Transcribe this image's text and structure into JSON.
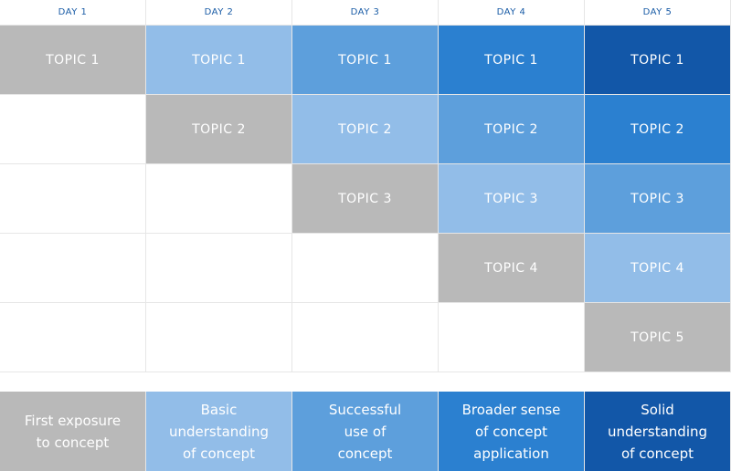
{
  "colors": {
    "gray": "#b9b9b9",
    "level1": "#92bde8",
    "level2": "#5d9fdc",
    "level3": "#2b80d0",
    "level4": "#1257a8",
    "empty": "#ffffff",
    "header_text": "#1a5ca6"
  },
  "days": [
    "DAY 1",
    "DAY 2",
    "DAY 3",
    "DAY 4",
    "DAY 5"
  ],
  "rows": [
    [
      {
        "label": "TOPIC 1",
        "level": 0
      },
      {
        "label": "TOPIC 1",
        "level": 1
      },
      {
        "label": "TOPIC 1",
        "level": 2
      },
      {
        "label": "TOPIC 1",
        "level": 3
      },
      {
        "label": "TOPIC 1",
        "level": 4
      }
    ],
    [
      {
        "label": "",
        "level": -1
      },
      {
        "label": "TOPIC 2",
        "level": 0
      },
      {
        "label": "TOPIC 2",
        "level": 1
      },
      {
        "label": "TOPIC 2",
        "level": 2
      },
      {
        "label": "TOPIC 2",
        "level": 3
      }
    ],
    [
      {
        "label": "",
        "level": -1
      },
      {
        "label": "",
        "level": -1
      },
      {
        "label": "TOPIC 3",
        "level": 0
      },
      {
        "label": "TOPIC 3",
        "level": 1
      },
      {
        "label": "TOPIC 3",
        "level": 2
      }
    ],
    [
      {
        "label": "",
        "level": -1
      },
      {
        "label": "",
        "level": -1
      },
      {
        "label": "",
        "level": -1
      },
      {
        "label": "TOPIC 4",
        "level": 0
      },
      {
        "label": "TOPIC 4",
        "level": 1
      }
    ],
    [
      {
        "label": "",
        "level": -1
      },
      {
        "label": "",
        "level": -1
      },
      {
        "label": "",
        "level": -1
      },
      {
        "label": "",
        "level": -1
      },
      {
        "label": "TOPIC 5",
        "level": 0
      }
    ]
  ],
  "legend": [
    {
      "text": "First exposure\nto concept",
      "level": 0
    },
    {
      "text": "Basic\nunderstanding\nof concept",
      "level": 1
    },
    {
      "text": "Successful\nuse of\nconcept",
      "level": 2
    },
    {
      "text": "Broader sense\nof concept\napplication",
      "level": 3
    },
    {
      "text": "Solid\nunderstanding\nof concept",
      "level": 4
    }
  ]
}
